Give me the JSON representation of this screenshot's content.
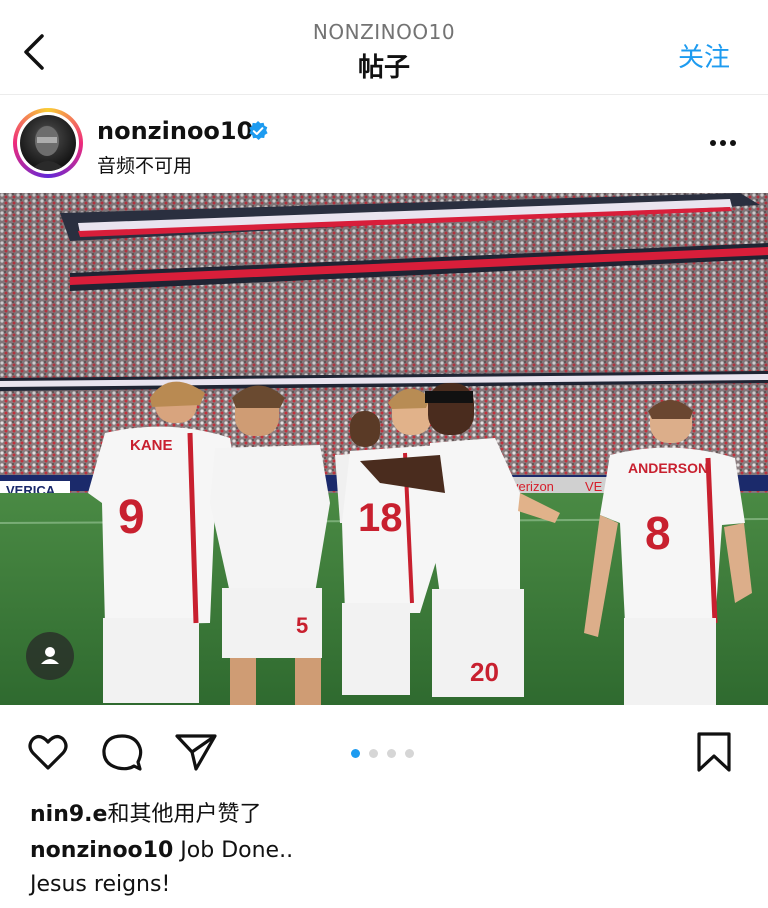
{
  "header": {
    "subtitle": "NONZINOO10",
    "title": "帖子",
    "follow_label": "关注"
  },
  "post": {
    "username": "nonzinoo10",
    "verified_icon": "verified-badge-icon",
    "audio_status": "音频不可用",
    "image": {
      "description_icon": "photo",
      "board_texts": [
        "VERICA",
        "verizon",
        "VE"
      ],
      "players": [
        {
          "name": "KANE",
          "number": "9"
        },
        {
          "name": "",
          "number": "5"
        },
        {
          "name": "",
          "number": "18"
        },
        {
          "name": "",
          "number": "20"
        },
        {
          "name": "ANDERSON",
          "number": "8"
        }
      ]
    },
    "carousel": {
      "count": 4,
      "active": 1
    },
    "likes_user": "nin9.e",
    "likes_suffix": "和其他用户赞了",
    "caption_user": "nonzinoo10",
    "caption_line1": "Job Done..",
    "caption_line2": "Jesus reigns!"
  },
  "colors": {
    "accent": "#1d9bf0",
    "pitch": "#3d7a3a",
    "kit_red": "#c8202f"
  }
}
